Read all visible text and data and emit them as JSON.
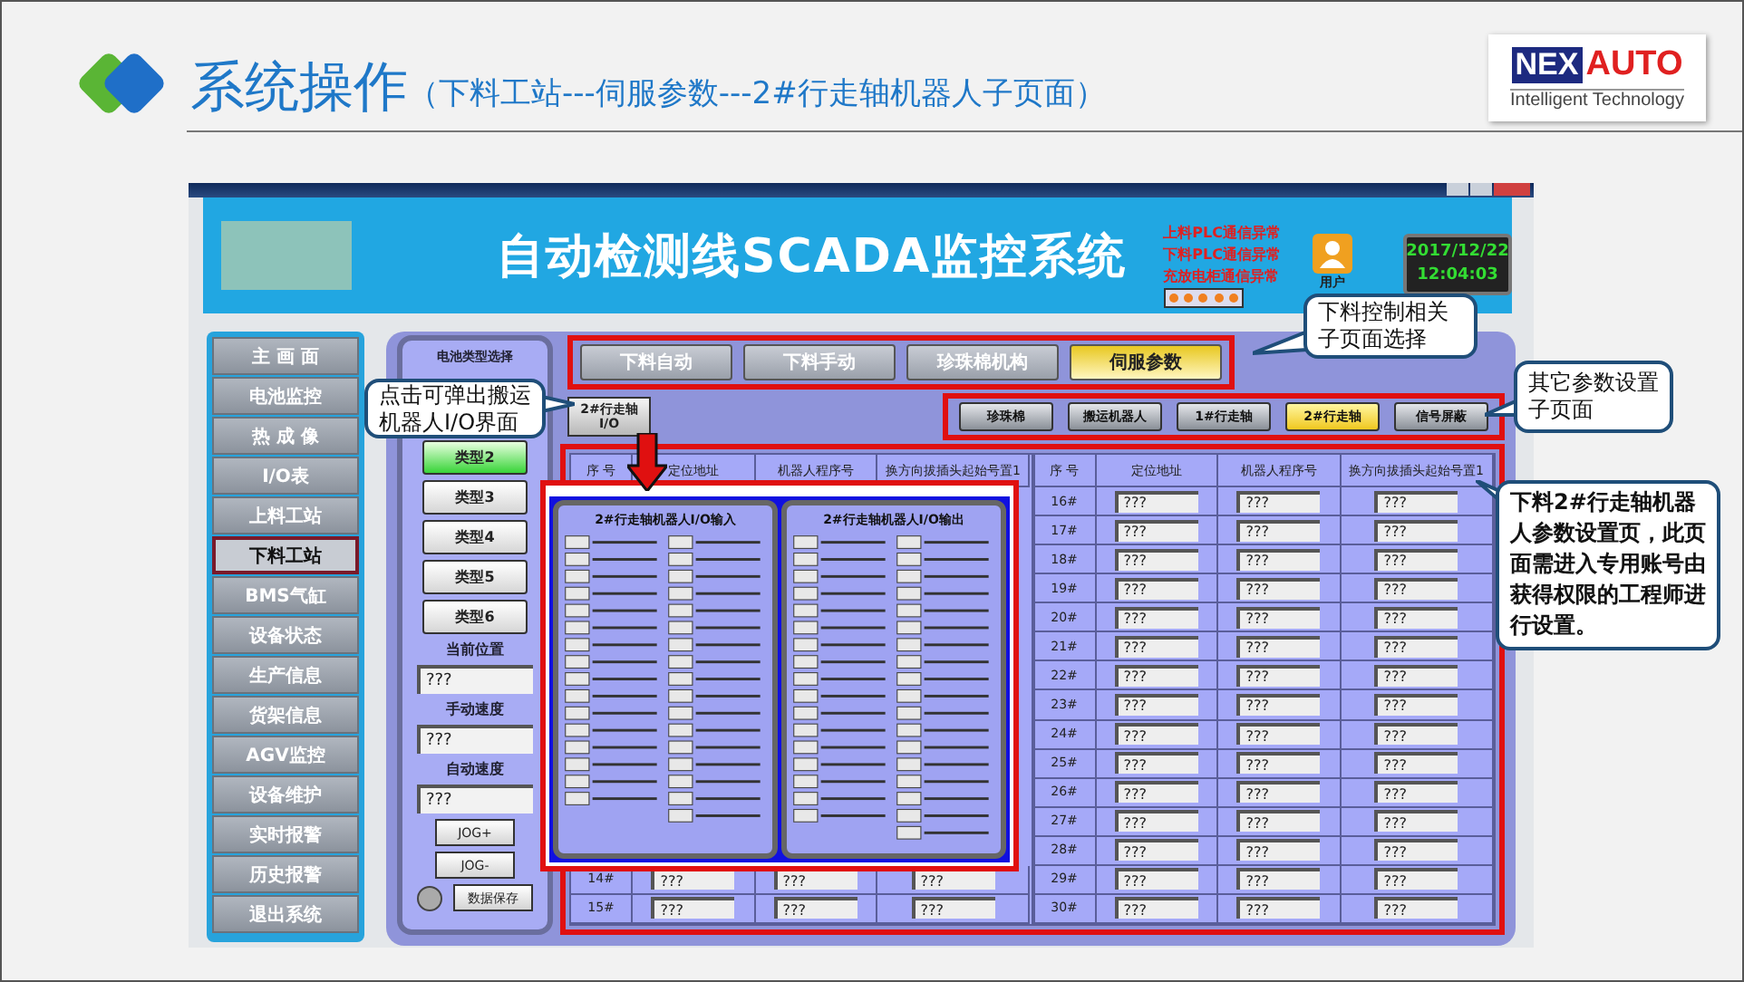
{
  "slide": {
    "title": "系统操作",
    "subtitle": "（下料工站---伺服参数---2#行走轴机器人子页面）",
    "logo": {
      "mark": "NEX",
      "brand": "AUTO",
      "tagline": "Intelligent Technology"
    }
  },
  "app": {
    "banner": {
      "title": "自动检测线SCADA监控系统",
      "alarms": [
        "上料PLC通信异常",
        "下料PLC通信异常",
        "充放电柜通信异常"
      ],
      "user_label": "用户",
      "date": "2017/12/22",
      "time": "12:04:03"
    },
    "nav": [
      {
        "label": "主 画 面",
        "selected": false
      },
      {
        "label": "电池监控",
        "selected": false
      },
      {
        "label": "热 成 像",
        "selected": false
      },
      {
        "label": "I/O表",
        "selected": false
      },
      {
        "label": "上料工站",
        "selected": false
      },
      {
        "label": "下料工站",
        "selected": true
      },
      {
        "label": "BMS气缸",
        "selected": false
      },
      {
        "label": "设备状态",
        "selected": false
      },
      {
        "label": "生产信息",
        "selected": false
      },
      {
        "label": "货架信息",
        "selected": false
      },
      {
        "label": "AGV监控",
        "selected": false
      },
      {
        "label": "设备维护",
        "selected": false
      },
      {
        "label": "实时报警",
        "selected": false
      },
      {
        "label": "历史报警",
        "selected": false
      },
      {
        "label": "退出系统",
        "selected": false
      }
    ],
    "type_panel": {
      "title": "电池类型选择",
      "types": [
        {
          "label": "类型2",
          "selected": true
        },
        {
          "label": "类型3",
          "selected": false
        },
        {
          "label": "类型4",
          "selected": false
        },
        {
          "label": "类型5",
          "selected": false
        },
        {
          "label": "类型6",
          "selected": false
        }
      ],
      "fields": [
        {
          "label": "当前位置",
          "value": "???"
        },
        {
          "label": "手动速度",
          "value": "???"
        },
        {
          "label": "自动速度",
          "value": "???"
        }
      ],
      "jog_buttons": [
        "JOG+",
        "JOG-"
      ],
      "save_button": "数据保存"
    },
    "main_tabs": [
      {
        "label": "下料自动",
        "selected": false
      },
      {
        "label": "下料手动",
        "selected": false
      },
      {
        "label": "珍珠棉机构",
        "selected": false
      },
      {
        "label": "伺服参数",
        "selected": true
      }
    ],
    "io_button": [
      "2#行走轴",
      "I/O"
    ],
    "sub_tabs": [
      {
        "label": "珍珠棉",
        "selected": false
      },
      {
        "label": "搬运机器人",
        "selected": false
      },
      {
        "label": "1#行走轴",
        "selected": false
      },
      {
        "label": "2#行走轴",
        "selected": true
      },
      {
        "label": "信号屏蔽",
        "selected": false
      }
    ],
    "table": {
      "left": {
        "columns": [
          "序 号",
          "定位地址",
          "机器人程序号",
          "换方向拔插头起始号置1"
        ],
        "rows": [
          {
            "no": "14#",
            "values": [
              "???",
              "???",
              "???"
            ]
          },
          {
            "no": "15#",
            "values": [
              "???",
              "???",
              "???"
            ]
          }
        ]
      },
      "right": {
        "columns": [
          "序 号",
          "定位地址",
          "机器人程序号",
          "换方向拔插头起始号置1"
        ],
        "rows": [
          {
            "no": "16#",
            "values": [
              "???",
              "???",
              "???"
            ]
          },
          {
            "no": "17#",
            "values": [
              "???",
              "???",
              "???"
            ]
          },
          {
            "no": "18#",
            "values": [
              "???",
              "???",
              "???"
            ]
          },
          {
            "no": "19#",
            "values": [
              "???",
              "???",
              "???"
            ]
          },
          {
            "no": "20#",
            "values": [
              "???",
              "???",
              "???"
            ]
          },
          {
            "no": "21#",
            "values": [
              "???",
              "???",
              "???"
            ]
          },
          {
            "no": "22#",
            "values": [
              "???",
              "???",
              "???"
            ]
          },
          {
            "no": "23#",
            "values": [
              "???",
              "???",
              "???"
            ]
          },
          {
            "no": "24#",
            "values": [
              "???",
              "???",
              "???"
            ]
          },
          {
            "no": "25#",
            "values": [
              "???",
              "???",
              "???"
            ]
          },
          {
            "no": "26#",
            "values": [
              "???",
              "???",
              "???"
            ]
          },
          {
            "no": "27#",
            "values": [
              "???",
              "???",
              "???"
            ]
          },
          {
            "no": "28#",
            "values": [
              "???",
              "???",
              "???"
            ]
          },
          {
            "no": "29#",
            "values": [
              "???",
              "???",
              "???"
            ]
          },
          {
            "no": "30#",
            "values": [
              "???",
              "???",
              "???"
            ]
          }
        ]
      }
    },
    "io_popup": {
      "panels": [
        {
          "title": "2#行走轴机器人I/O输入"
        },
        {
          "title": "2#行走轴机器人I/O输出"
        }
      ]
    }
  },
  "callouts": [
    {
      "text": "点击可弹出搬运机器人I/O界面"
    },
    {
      "text": "下料控制相关子页面选择"
    },
    {
      "text": "其它参数设置子页面"
    },
    {
      "text": "下料2#行走轴机器人参数设置页，此页面需进入专用账号由获得权限的工程师进行设置。"
    }
  ]
}
